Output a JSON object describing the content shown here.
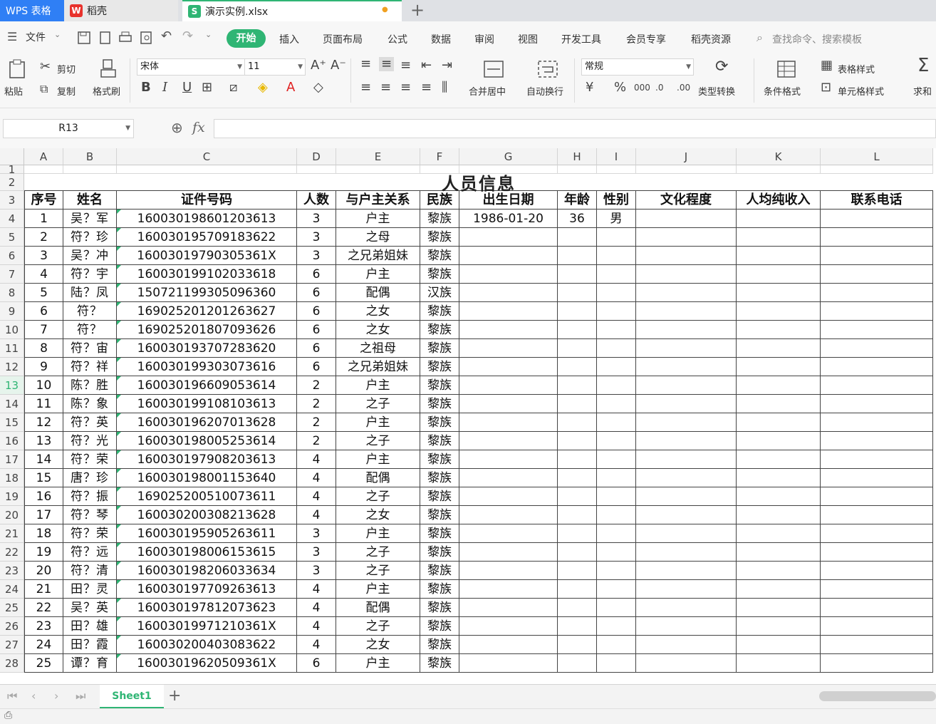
{
  "tabs": {
    "app": "WPS 表格",
    "daoke": "稻壳",
    "file": "演示实例.xlsx",
    "file_modified_dot": "●",
    "new_tab": "+"
  },
  "menu": {
    "file": "文件",
    "items": [
      "开始",
      "插入",
      "页面布局",
      "公式",
      "数据",
      "审阅",
      "视图",
      "开发工具",
      "会员专享",
      "稻壳资源"
    ],
    "search_placeholder": "查找命令、搜索模板"
  },
  "ribbon": {
    "paste": "粘贴",
    "cut": "剪切",
    "copy": "复制",
    "format_painter": "格式刷",
    "font_name": "宋体",
    "font_size": "11",
    "merge_center": "合并居中",
    "wrap_text": "自动换行",
    "number_format": "常规",
    "type_convert": "类型转换",
    "conditional_format": "条件格式",
    "table_style": "表格样式",
    "cell_style": "单元格样式",
    "sum": "求和"
  },
  "formula": {
    "name_box": "R13",
    "fx": "fx",
    "value": ""
  },
  "grid": {
    "columns": [
      "A",
      "B",
      "C",
      "D",
      "E",
      "F",
      "G",
      "H",
      "I",
      "J",
      "K",
      "L"
    ],
    "selected_row": 13,
    "title": "人员信息",
    "headers": [
      "序号",
      "姓名",
      "证件号码",
      "人数",
      "与户主关系",
      "民族",
      "出生日期",
      "年龄",
      "性别",
      "文化程度",
      "人均纯收入",
      "联系电话"
    ],
    "rows": [
      [
        "1",
        "吴？军",
        "160030198601203613",
        "3",
        "户主",
        "黎族",
        "1986-01-20",
        "36",
        "男",
        "",
        "",
        ""
      ],
      [
        "2",
        "符？珍",
        "160030195709183622",
        "3",
        "之母",
        "黎族",
        "",
        "",
        "",
        "",
        "",
        ""
      ],
      [
        "3",
        "吴？冲",
        "16003019790305361X",
        "3",
        "之兄弟姐妹",
        "黎族",
        "",
        "",
        "",
        "",
        "",
        ""
      ],
      [
        "4",
        "符？宇",
        "160030199102033618",
        "6",
        "户主",
        "黎族",
        "",
        "",
        "",
        "",
        "",
        ""
      ],
      [
        "5",
        "陆？凤",
        "150721199305096360",
        "6",
        "配偶",
        "汉族",
        "",
        "",
        "",
        "",
        "",
        ""
      ],
      [
        "6",
        "符？",
        "169025201201263627",
        "6",
        "之女",
        "黎族",
        "",
        "",
        "",
        "",
        "",
        ""
      ],
      [
        "7",
        "符？",
        "169025201807093626",
        "6",
        "之女",
        "黎族",
        "",
        "",
        "",
        "",
        "",
        ""
      ],
      [
        "8",
        "符？宙",
        "160030193707283620",
        "6",
        "之祖母",
        "黎族",
        "",
        "",
        "",
        "",
        "",
        ""
      ],
      [
        "9",
        "符？祥",
        "160030199303073616",
        "6",
        "之兄弟姐妹",
        "黎族",
        "",
        "",
        "",
        "",
        "",
        ""
      ],
      [
        "10",
        "陈？胜",
        "160030196609053614",
        "2",
        "户主",
        "黎族",
        "",
        "",
        "",
        "",
        "",
        ""
      ],
      [
        "11",
        "陈？象",
        "160030199108103613",
        "2",
        "之子",
        "黎族",
        "",
        "",
        "",
        "",
        "",
        ""
      ],
      [
        "12",
        "符？英",
        "160030196207013628",
        "2",
        "户主",
        "黎族",
        "",
        "",
        "",
        "",
        "",
        ""
      ],
      [
        "13",
        "符？光",
        "160030198005253614",
        "2",
        "之子",
        "黎族",
        "",
        "",
        "",
        "",
        "",
        ""
      ],
      [
        "14",
        "符？荣",
        "160030197908203613",
        "4",
        "户主",
        "黎族",
        "",
        "",
        "",
        "",
        "",
        ""
      ],
      [
        "15",
        "唐？珍",
        "160030198001153640",
        "4",
        "配偶",
        "黎族",
        "",
        "",
        "",
        "",
        "",
        ""
      ],
      [
        "16",
        "符？振",
        "169025200510073611",
        "4",
        "之子",
        "黎族",
        "",
        "",
        "",
        "",
        "",
        ""
      ],
      [
        "17",
        "符？琴",
        "160030200308213628",
        "4",
        "之女",
        "黎族",
        "",
        "",
        "",
        "",
        "",
        ""
      ],
      [
        "18",
        "符？荣",
        "160030195905263611",
        "3",
        "户主",
        "黎族",
        "",
        "",
        "",
        "",
        "",
        ""
      ],
      [
        "19",
        "符？远",
        "160030198006153615",
        "3",
        "之子",
        "黎族",
        "",
        "",
        "",
        "",
        "",
        ""
      ],
      [
        "20",
        "符？清",
        "160030198206033634",
        "3",
        "之子",
        "黎族",
        "",
        "",
        "",
        "",
        "",
        ""
      ],
      [
        "21",
        "田？灵",
        "160030197709263613",
        "4",
        "户主",
        "黎族",
        "",
        "",
        "",
        "",
        "",
        ""
      ],
      [
        "22",
        "吴？英",
        "160030197812073623",
        "4",
        "配偶",
        "黎族",
        "",
        "",
        "",
        "",
        "",
        ""
      ],
      [
        "23",
        "田？雄",
        "16003019971210361X",
        "4",
        "之子",
        "黎族",
        "",
        "",
        "",
        "",
        "",
        ""
      ],
      [
        "24",
        "田？霞",
        "160030200403083622",
        "4",
        "之女",
        "黎族",
        "",
        "",
        "",
        "",
        "",
        ""
      ],
      [
        "25",
        "谭？育",
        "16003019620509361X",
        "6",
        "户主",
        "黎族",
        "",
        "",
        "",
        "",
        "",
        ""
      ]
    ]
  },
  "sheets": {
    "active": "Sheet1",
    "add": "+"
  }
}
